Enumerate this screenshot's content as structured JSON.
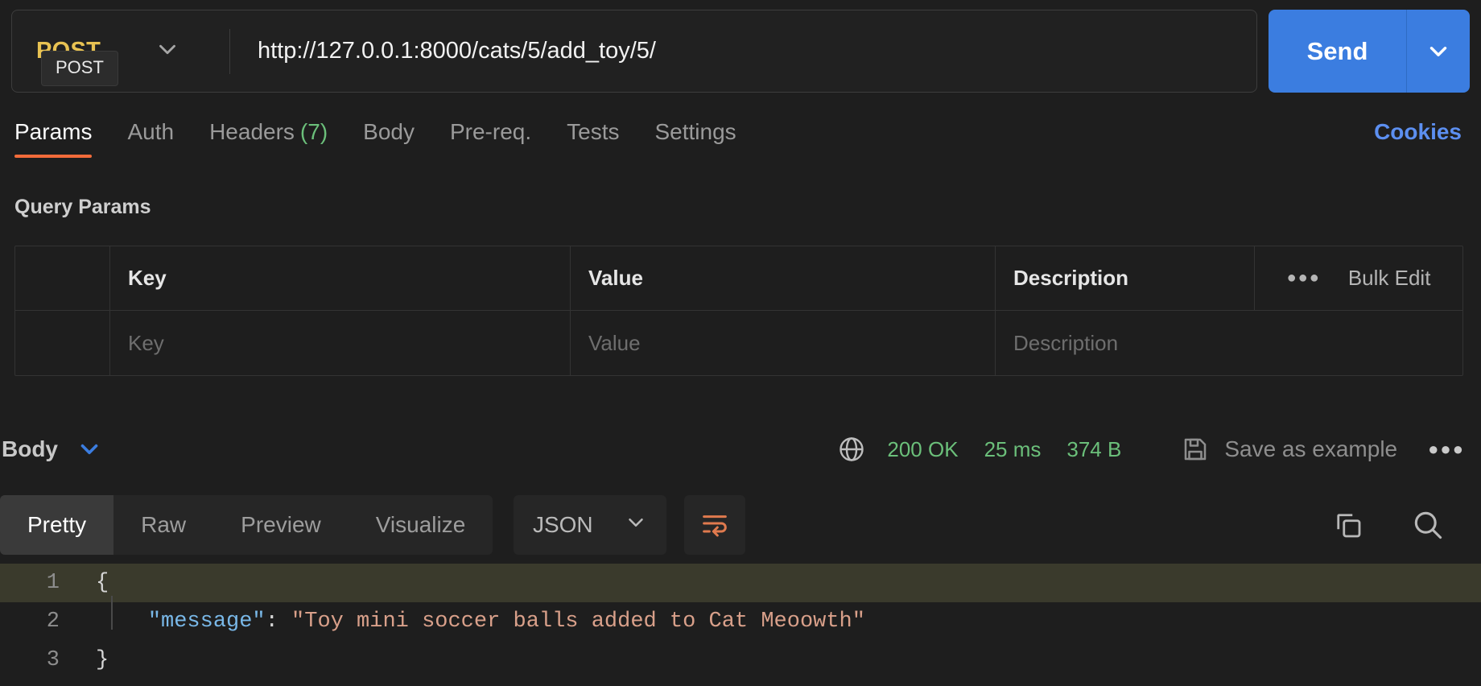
{
  "request": {
    "method": "POST",
    "method_tooltip": "POST",
    "url": "http://127.0.0.1:8000/cats/5/add_toy/5/",
    "send_label": "Send",
    "method_chevron_icon": "chevron-down-icon",
    "send_chevron_icon": "chevron-down-icon"
  },
  "request_tabs": [
    {
      "label": "Params",
      "count": "",
      "active": true
    },
    {
      "label": "Auth",
      "count": "",
      "active": false
    },
    {
      "label": "Headers",
      "count": "(7)",
      "active": false
    },
    {
      "label": "Body",
      "count": "",
      "active": false
    },
    {
      "label": "Pre-req.",
      "count": "",
      "active": false
    },
    {
      "label": "Tests",
      "count": "",
      "active": false
    },
    {
      "label": "Settings",
      "count": "",
      "active": false
    }
  ],
  "cookies_link": "Cookies",
  "query_params": {
    "title": "Query Params",
    "headers": {
      "key": "Key",
      "value": "Value",
      "description": "Description"
    },
    "bulk_edit": {
      "label": "Bulk Edit",
      "icon": "three-dots-icon"
    },
    "rows": [
      {
        "key": "Key",
        "value": "Value",
        "description": "Description"
      }
    ]
  },
  "response_meta": {
    "body_label": "Body",
    "body_chevron_icon": "chevron-down-icon",
    "network_icon": "globe-icon",
    "status": "200 OK",
    "time": "25 ms",
    "size": "374 B",
    "save_example_label": "Save as example",
    "save_icon": "floppy-disk-icon",
    "more_icon": "three-dots-icon"
  },
  "response_tabs": [
    {
      "label": "Pretty",
      "active": true
    },
    {
      "label": "Raw",
      "active": false
    },
    {
      "label": "Preview",
      "active": false
    },
    {
      "label": "Visualize",
      "active": false
    }
  ],
  "response_toolbar": {
    "format": "JSON",
    "format_chevron_icon": "chevron-down-icon",
    "wrap_icon": "word-wrap-icon",
    "copy_icon": "copy-icon",
    "search_icon": "search-icon"
  },
  "response_body": {
    "language": "json",
    "lines": [
      {
        "number": "1",
        "text": "{",
        "highlighted": true
      },
      {
        "number": "2",
        "key": "\"message\"",
        "sep": ": ",
        "value": "\"Toy mini soccer balls added to Cat Meoowth\"",
        "indent": "    ",
        "highlighted": false
      },
      {
        "number": "3",
        "text": "}",
        "highlighted": false
      }
    ]
  },
  "colors": {
    "accent_orange": "#f26b3a",
    "send_blue": "#3b7de0",
    "link_blue": "#5c8ff0",
    "status_green": "#6bbf7a",
    "method_post": "#e8c252",
    "json_key": "#79b8e8",
    "json_string": "#d9a08a",
    "background": "#1e1e1e"
  }
}
